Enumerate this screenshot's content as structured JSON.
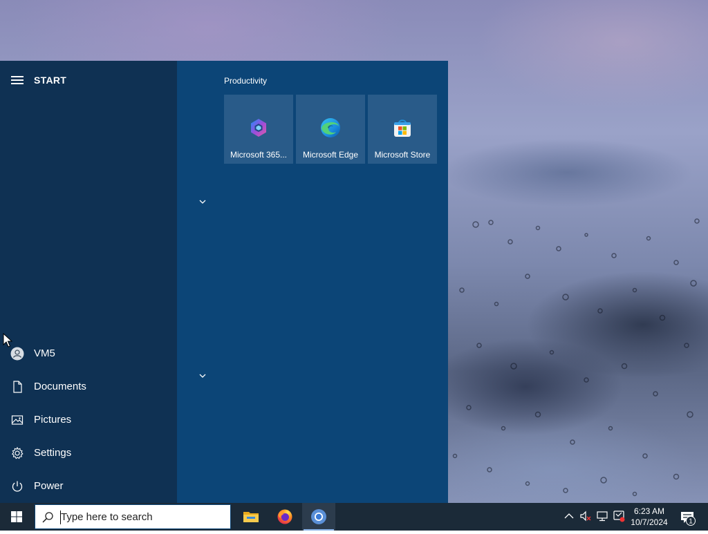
{
  "start_menu": {
    "title": "START",
    "left_items": [
      {
        "label": "VM5",
        "icon": "user-icon"
      },
      {
        "label": "Documents",
        "icon": "document-icon"
      },
      {
        "label": "Pictures",
        "icon": "pictures-icon"
      },
      {
        "label": "Settings",
        "icon": "gear-icon"
      },
      {
        "label": "Power",
        "icon": "power-icon"
      }
    ],
    "group_header": "Productivity",
    "tiles": [
      {
        "label": "Microsoft 365...",
        "icon": "microsoft-365-icon"
      },
      {
        "label": "Microsoft Edge",
        "icon": "edge-icon"
      },
      {
        "label": "Microsoft Store",
        "icon": "store-icon"
      }
    ]
  },
  "taskbar": {
    "search_placeholder": "Type here to search",
    "pinned_apps": [
      {
        "name": "File Explorer",
        "icon": "folder-icon"
      },
      {
        "name": "Firefox",
        "icon": "firefox-icon"
      },
      {
        "name": "Chrome",
        "icon": "chrome-icon",
        "active": true
      }
    ],
    "clock": {
      "time": "6:23 AM",
      "date": "10/7/2024"
    },
    "notification_count": "1"
  },
  "colors": {
    "start_left_bg": "#0f3153",
    "start_right_bg": "#0c4577",
    "tile_bg": "#295b89",
    "taskbar_bg": "#1b2a38"
  }
}
